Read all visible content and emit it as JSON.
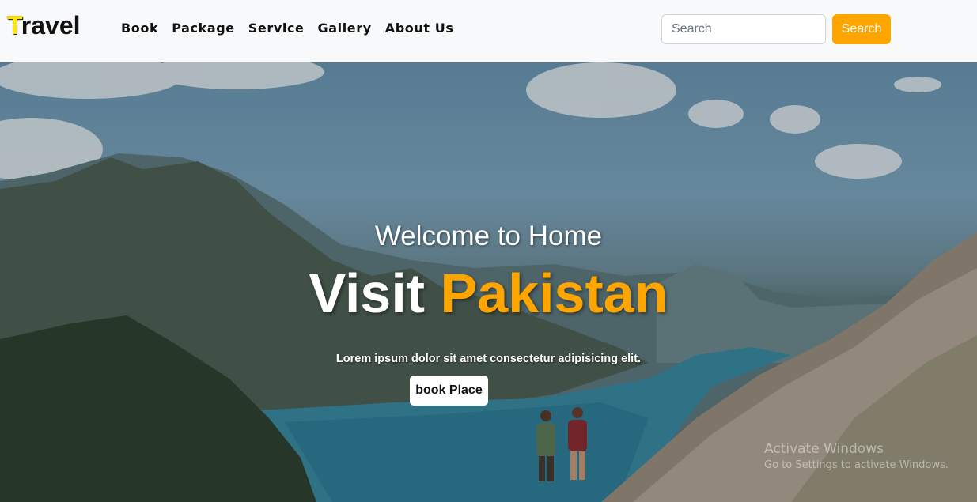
{
  "brand": {
    "first_letter": "T",
    "rest": "ravel",
    "accent_color": "#ffe600"
  },
  "nav": {
    "items": [
      {
        "label": "Book"
      },
      {
        "label": "Package"
      },
      {
        "label": "Service"
      },
      {
        "label": "Gallery"
      },
      {
        "label": "About Us"
      }
    ]
  },
  "search": {
    "placeholder": "Search",
    "value": "",
    "button_label": "Search",
    "button_color": "#ffa500"
  },
  "hero": {
    "welcome": "Welcome to Home",
    "title_prefix": "Visit",
    "title_accent": "Pakistan",
    "accent_color": "#ffa500",
    "subtitle": "Lorem ipsum dolor sit amet consectetur adipisicing elit.",
    "cta_label": "book Place"
  },
  "watermark": {
    "title": "Activate Windows",
    "subtitle": "Go to Settings to activate Windows."
  }
}
